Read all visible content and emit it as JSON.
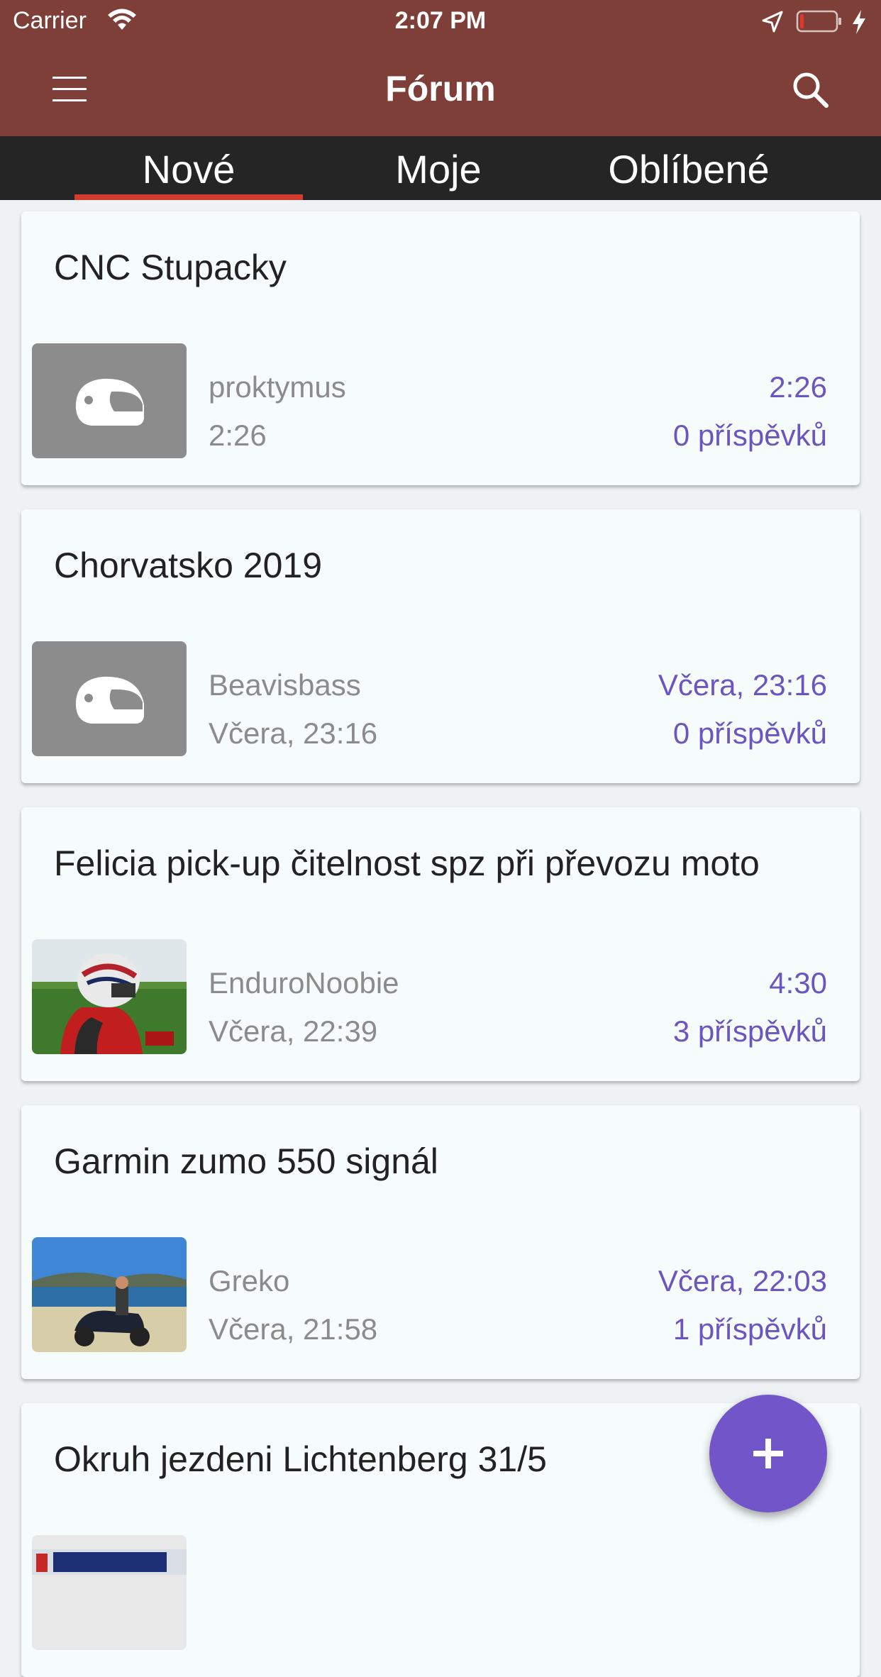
{
  "status_bar": {
    "carrier": "Carrier",
    "time": "2:07 PM",
    "icons": [
      "wifi-icon",
      "location-arrow-icon",
      "battery-low-icon",
      "charging-bolt-icon"
    ]
  },
  "app_bar": {
    "title": "Fórum",
    "icons": [
      "hamburger-menu-icon",
      "search-icon"
    ],
    "background": "#7e3f39"
  },
  "tabs": {
    "items": [
      {
        "label": "Nové",
        "selected": true
      },
      {
        "label": "Moje",
        "selected": false
      },
      {
        "label": "Oblíbené",
        "selected": false
      }
    ],
    "indicator_color": "#d23b2f"
  },
  "threads": [
    {
      "title": "CNC Stupacky",
      "author": "proktymus",
      "created": "2:26",
      "last_activity": "2:26",
      "posts": "0 příspěvků",
      "avatar": "helmet-placeholder-icon"
    },
    {
      "title": "Chorvatsko 2019",
      "author": "Beavisbass",
      "created": "Včera, 23:16",
      "last_activity": "Včera, 23:16",
      "posts": "0 příspěvků",
      "avatar": "helmet-placeholder-icon"
    },
    {
      "title": "Felicia pick-up čitelnost spz při převozu moto",
      "author": "EnduroNoobie",
      "created": "Včera, 22:39",
      "last_activity": "4:30",
      "posts": "3 příspěvků",
      "avatar": "rider-with-helmet-photo"
    },
    {
      "title": "Garmin zumo 550 signál",
      "author": "Greko",
      "created": "Včera, 21:58",
      "last_activity": "Včera, 22:03",
      "posts": "1 příspěvků",
      "avatar": "motorcycle-at-sea-photo"
    },
    {
      "title": "Okruh jezdeni Lichtenberg 31/5",
      "author": "",
      "created": "",
      "last_activity": "",
      "posts": "",
      "avatar": "banner-photo"
    }
  ],
  "fab": {
    "icon": "plus-icon",
    "color": "#7255c9"
  },
  "colors": {
    "accent": "#6b55c0",
    "meta_text": "#8b8b8b"
  }
}
